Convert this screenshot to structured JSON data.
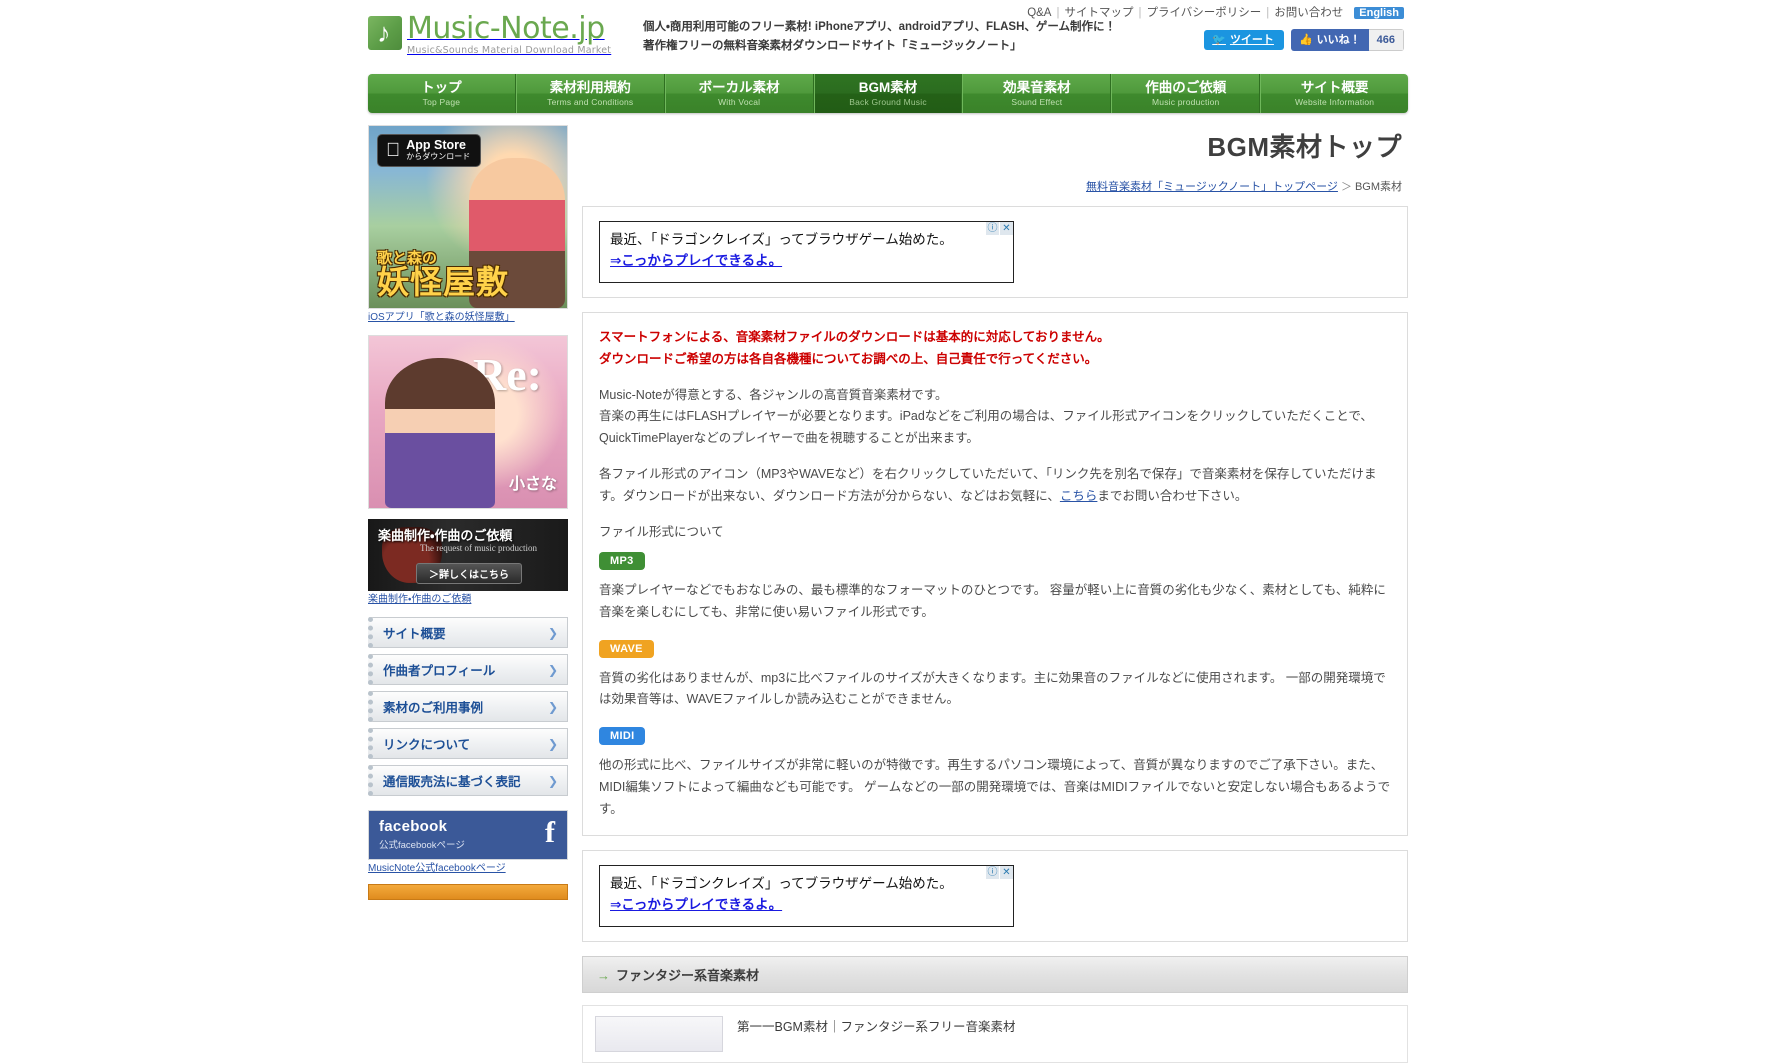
{
  "site": {
    "logo_title": "Music-Note.jp",
    "logo_subtitle": "Music&Sounds Material Download Market",
    "tagline_line1": "個人・商用利用可能のフリー素材! iPhoneアプリ、androidアプリ、FLASH、ゲーム制作に！",
    "tagline_line2": "著作権フリーの無料音楽素材ダウンロードサイト「ミュージックノート」"
  },
  "toplinks": {
    "items": [
      "Q&A",
      "サイトマップ",
      "プライバシーポリシー",
      "お問い合わせ"
    ],
    "english_label": "English"
  },
  "social": {
    "tweet_label": "ツイート",
    "tweet_icon": "twitter-bird-icon",
    "fb_like_label": "いいね！",
    "fb_like_count": "466",
    "fb_icon": "thumbs-up-icon"
  },
  "nav": {
    "items": [
      {
        "ja": "トップ",
        "en": "Top Page",
        "active": false
      },
      {
        "ja": "素材利用規約",
        "en": "Terms and Conditions",
        "active": false
      },
      {
        "ja": "ボーカル素材",
        "en": "With Vocal",
        "active": false
      },
      {
        "ja": "BGM素材",
        "en": "Back Ground Music",
        "active": true
      },
      {
        "ja": "効果音素材",
        "en": "Sound Effect",
        "active": false
      },
      {
        "ja": "作曲のご依頼",
        "en": "Music production",
        "active": false
      },
      {
        "ja": "サイト概要",
        "en": "Website Information",
        "active": false
      }
    ]
  },
  "sidebar": {
    "banner_yokai": {
      "appstore_line1": "App Store",
      "appstore_line2": "からダウンロード",
      "apple_icon": "apple-logo-icon",
      "title_line1": "歌と森の",
      "title_line2": "妖怪屋敷",
      "caption": "iOSアプリ「歌と森の妖怪屋敷」"
    },
    "banner_re": {
      "logo_text": "Re:",
      "small_caption": "小さな"
    },
    "banner_order": {
      "title": "楽曲制作・作曲のご依頼",
      "subtitle": "The request of music production",
      "button_label": "＞詳しくはこちら",
      "caption": "楽曲制作・作曲のご依頼"
    },
    "menu_items": [
      {
        "label": "サイト概要"
      },
      {
        "label": "作曲者プロフィール"
      },
      {
        "label": "素材のご利用事例"
      },
      {
        "label": "リンクについて"
      },
      {
        "label": "通信販売法に基づく表記"
      }
    ],
    "facebook": {
      "title": "facebook",
      "subtitle": "公式facebookページ",
      "glyph": "f",
      "caption": "MusicNote公式facebookページ"
    }
  },
  "main": {
    "page_title": "BGM素材トップ",
    "breadcrumb": {
      "home_label": "無料音楽素材「ミュージックノート」トップページ",
      "separator": "＞",
      "current": "BGM素材"
    },
    "ad_top": {
      "line1": "最近、「ドラゴンクレイズ」ってブラウザゲーム始めた。",
      "line2": "⇒こっからプレイできるよ。",
      "info_icon": "ad-info-icon",
      "close_icon": "ad-close-icon"
    },
    "ad_bottom": {
      "line1": "最近、「ドラゴンクレイズ」ってブラウザゲーム始めた。",
      "line2": "⇒こっからプレイできるよ。",
      "info_icon": "ad-info-icon",
      "close_icon": "ad-close-icon"
    },
    "warning": {
      "line1": "スマートフォンによる、音楽素材ファイルのダウンロードは基本的に対応しておりません。",
      "line2": "ダウンロードご希望の方は各自各機種についてお調べの上、自己責任で行ってください。"
    },
    "intro": {
      "line1": "Music-Noteが得意とする、各ジャンルの高音質音楽素材です。",
      "line2": "音楽の再生にはFLASHプレイヤーが必要となります。iPadなどをご利用の場合は、ファイル形式アイコンをクリックしていただくことで、",
      "line3": "QuickTimePlayerなどのプレイヤーで曲を視聴することが出来ます。"
    },
    "download_note": {
      "part1": "各ファイル形式のアイコン（MP3やWAVEなど）を右クリックしていただいて、「リンク先を別名で保存」で音楽素材を保存していただけます。ダウンロードが出来ない、ダウンロード方法が分からない、などはお気軽に、",
      "link_label": "こちら",
      "part2": "までお問い合わせ下さい。"
    },
    "formats_heading": "ファイル形式について",
    "formats": [
      {
        "tag": "MP3",
        "color": "#3f8f35",
        "description": "音楽プレイヤーなどでもおなじみの、最も標準的なフォーマットのひとつです。 容量が軽い上に音質の劣化も少なく、素材としても、純粋に音楽を楽しむにしても、非常に使い易いファイル形式です。"
      },
      {
        "tag": "WAVE",
        "color": "#f0a321",
        "description": "音質の劣化はありませんが、mp3に比べファイルのサイズが大きくなります。主に効果音のファイルなどに使用されます。 一部の開発環境では効果音等は、WAVEファイルしか読み込むことができません。"
      },
      {
        "tag": "MIDI",
        "color": "#2f86e0",
        "description": "他の形式に比べ、ファイルサイズが非常に軽いのが特徴です。再生するパソコン環境によって、音質が異なりますのでご了承下さい。また、MIDI編集ソフトによって編曲なども可能です。 ゲームなどの一部の開発環境では、音楽はMIDIファイルでないと安定しない場合もあるようです。"
      }
    ],
    "section_fantasy": {
      "arrow_icon": "arrow-right-icon",
      "label": "ファンタジー系音楽素材"
    },
    "first_track": {
      "title": "第一一BGM素材｜ファンタジー系フリー音楽素材"
    }
  }
}
